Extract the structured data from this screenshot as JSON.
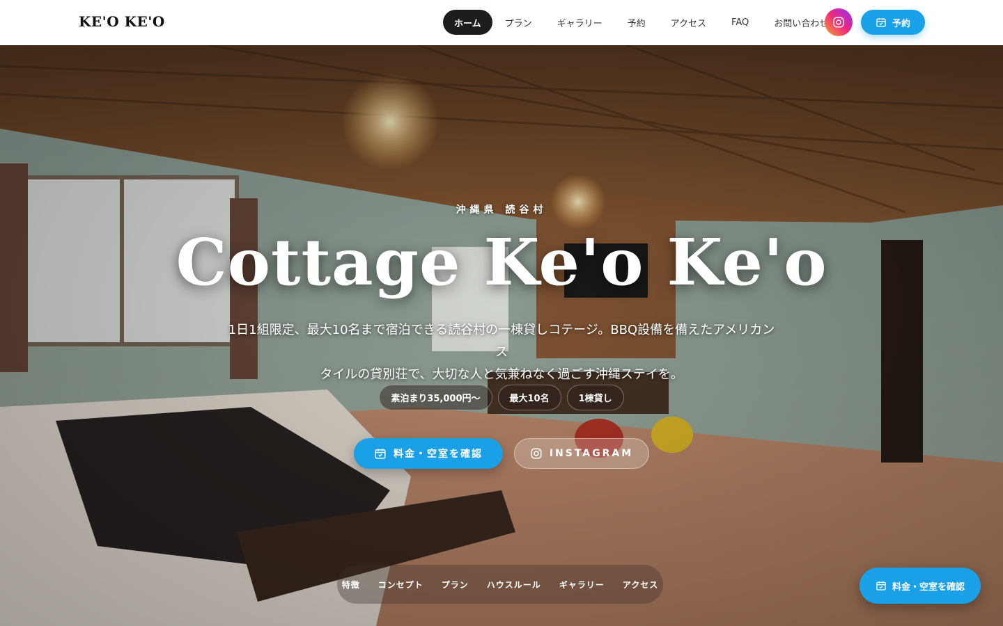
{
  "header": {
    "logo": "KE'O KE'O",
    "nav": [
      {
        "label": "ホーム",
        "active": true
      },
      {
        "label": "プラン",
        "active": false
      },
      {
        "label": "ギャラリー",
        "active": false
      },
      {
        "label": "予約",
        "active": false
      },
      {
        "label": "アクセス",
        "active": false
      },
      {
        "label": "FAQ",
        "active": false
      },
      {
        "label": "お問い合わせ",
        "active": false
      }
    ],
    "instagram_icon": "instagram-icon",
    "reserve_label": "予約",
    "reserve_icon": "calendar-icon"
  },
  "hero": {
    "eyebrow": "沖縄県 読谷村",
    "title": "Cottage Ke'o Ke'o",
    "description_line1": "1日1組限定、最大10名まで宿泊できる読谷村の一棟貸しコテージ。BBQ設備を備えたアメリカンス",
    "description_line2": "タイルの貸別荘で、大切な人と気兼ねなく過ごす沖縄ステイを。",
    "chips": [
      "素泊まり35,000円〜",
      "最大10名",
      "1棟貸し"
    ],
    "cta_primary": "料金・空室を確認",
    "cta_secondary": "INSTAGRAM"
  },
  "subnav": [
    "特徴",
    "コンセプト",
    "プラン",
    "ハウスルール",
    "ギャラリー",
    "アクセス"
  ],
  "floating_cta": "料金・空室を確認",
  "colors": {
    "accent": "#1aa0e6",
    "nav_active_bg": "#1c1c1c",
    "header_bg": "#ffffff"
  }
}
